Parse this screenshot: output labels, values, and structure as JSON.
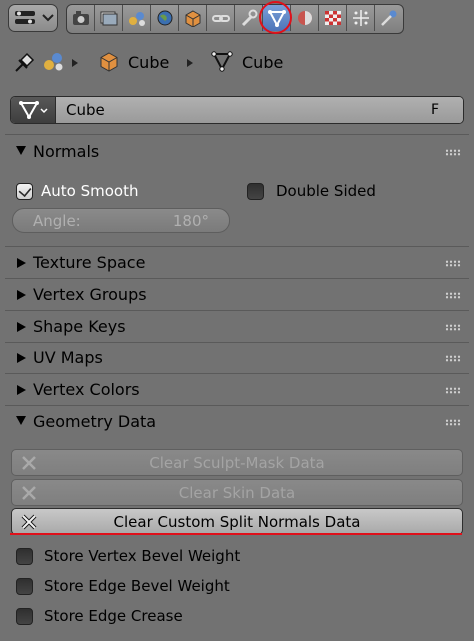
{
  "toolbar": {
    "editor_type_icon": "properties-editor-icon",
    "tabs": [
      "render-icon",
      "render-layers-icon",
      "scene-icon",
      "world-icon",
      "object-icon",
      "constraints-icon",
      "modifiers-icon",
      "mesh-data-icon",
      "material-icon",
      "texture-icon",
      "particles-icon",
      "physics-icon"
    ],
    "active_tab": "mesh-data-icon",
    "highlight_color": "#e0101a"
  },
  "breadcrumb": {
    "pin_icon": "pin-icon",
    "scene_icon": "scene-icon",
    "object_name": "Cube",
    "mesh_name": "Cube"
  },
  "datablock": {
    "name": "Cube",
    "fake_user": "F"
  },
  "normals": {
    "title": "Normals",
    "auto_smooth_label": "Auto Smooth",
    "auto_smooth_checked": true,
    "double_sided_label": "Double Sided",
    "double_sided_checked": false,
    "angle_label": "Angle:",
    "angle_value": "180°"
  },
  "collapsed_panels": [
    "Texture Space",
    "Vertex Groups",
    "Shape Keys",
    "UV Maps",
    "Vertex Colors"
  ],
  "geometry": {
    "title": "Geometry Data",
    "buttons": [
      {
        "label": "Clear Sculpt-Mask Data",
        "enabled": false
      },
      {
        "label": "Clear Skin Data",
        "enabled": false
      },
      {
        "label": "Clear Custom Split Normals Data",
        "enabled": true
      }
    ],
    "checkboxes": [
      {
        "label": "Store Vertex Bevel Weight",
        "checked": false
      },
      {
        "label": "Store Edge Bevel Weight",
        "checked": false
      },
      {
        "label": "Store Edge Crease",
        "checked": false
      }
    ]
  }
}
